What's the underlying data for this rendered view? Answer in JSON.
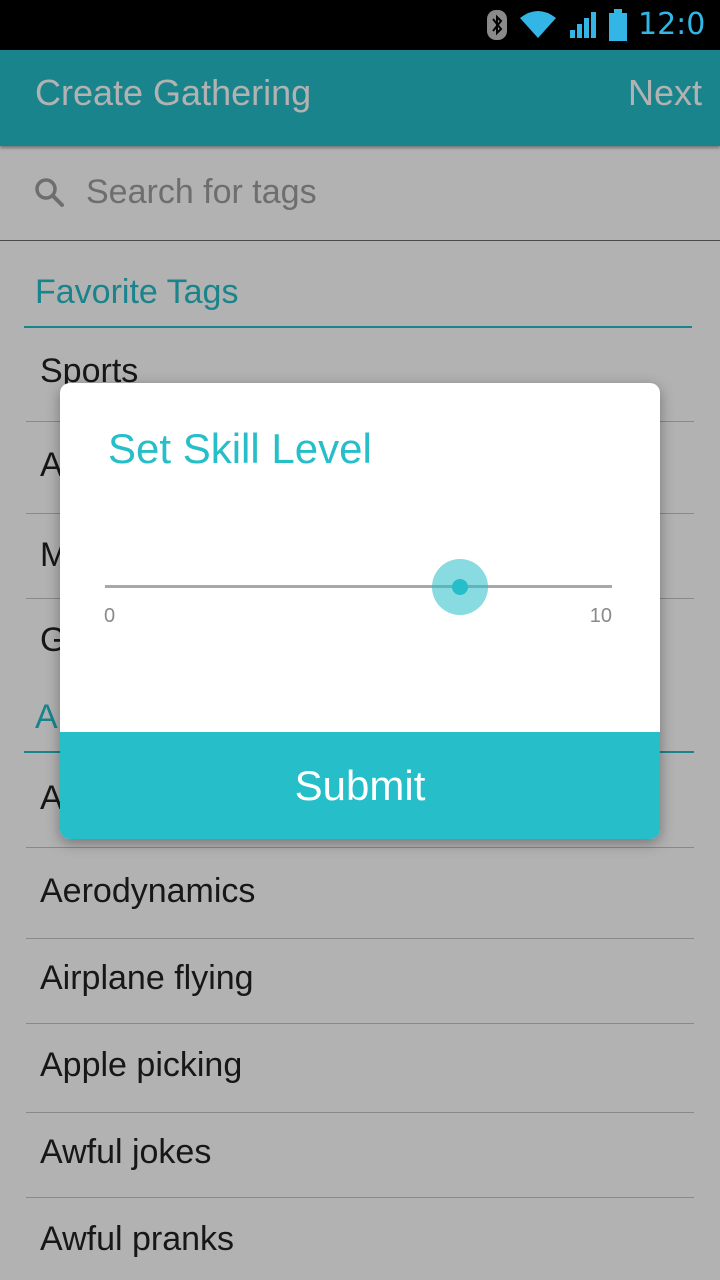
{
  "status_bar": {
    "clock": "12:0",
    "icons": [
      "bluetooth-icon",
      "wifi-icon",
      "signal-icon",
      "battery-icon"
    ]
  },
  "app_bar": {
    "title": "Create Gathering",
    "next_label": "Next"
  },
  "search": {
    "placeholder": "Search for tags",
    "value": ""
  },
  "favorites": {
    "header": "Favorite Tags",
    "items": [
      "Sports",
      "A",
      "M",
      "G"
    ]
  },
  "all_tags": {
    "header": "A",
    "items": [
      "A",
      "Aerodynamics",
      "Airplane flying",
      "Apple picking",
      "Awful jokes",
      "Awful pranks"
    ]
  },
  "dialog": {
    "title": "Set Skill Level",
    "slider": {
      "min_label": "0",
      "max_label": "10",
      "value_fraction": 0.7
    },
    "submit_label": "Submit"
  },
  "colors": {
    "accent": "#25bec9",
    "status_bar": "#000000",
    "clock": "#33b5e5"
  }
}
